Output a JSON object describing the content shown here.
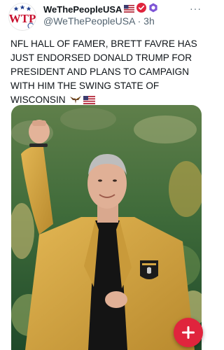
{
  "post": {
    "display_name": "WeThePeopleUSA",
    "handle": "@WeThePeopleUSA",
    "separator": "·",
    "age": "3h",
    "avatar_logo_text": "WTP",
    "text": "NFL HALL OF FAMER, BRETT FAVRE HAS JUST ENDORSED DONALD TRUMP FOR PRESIDENT AND PLANS TO CAMPAIGN WITH HIM THE SWING STATE OF WISCONSIN",
    "emojis": [
      "eagle-emoji",
      "us-flag-emoji"
    ],
    "photo_patch_text": "PRO FOOTBALL HALL OF FAME"
  },
  "more_label": "···",
  "compose_label": "+",
  "colors": {
    "verified_red": "#e0243d",
    "hexagon_purple": "#7e55d6",
    "jacket_gold": "#d4a542",
    "fab_red": "#e0243d",
    "secondary_text": "#536471"
  }
}
